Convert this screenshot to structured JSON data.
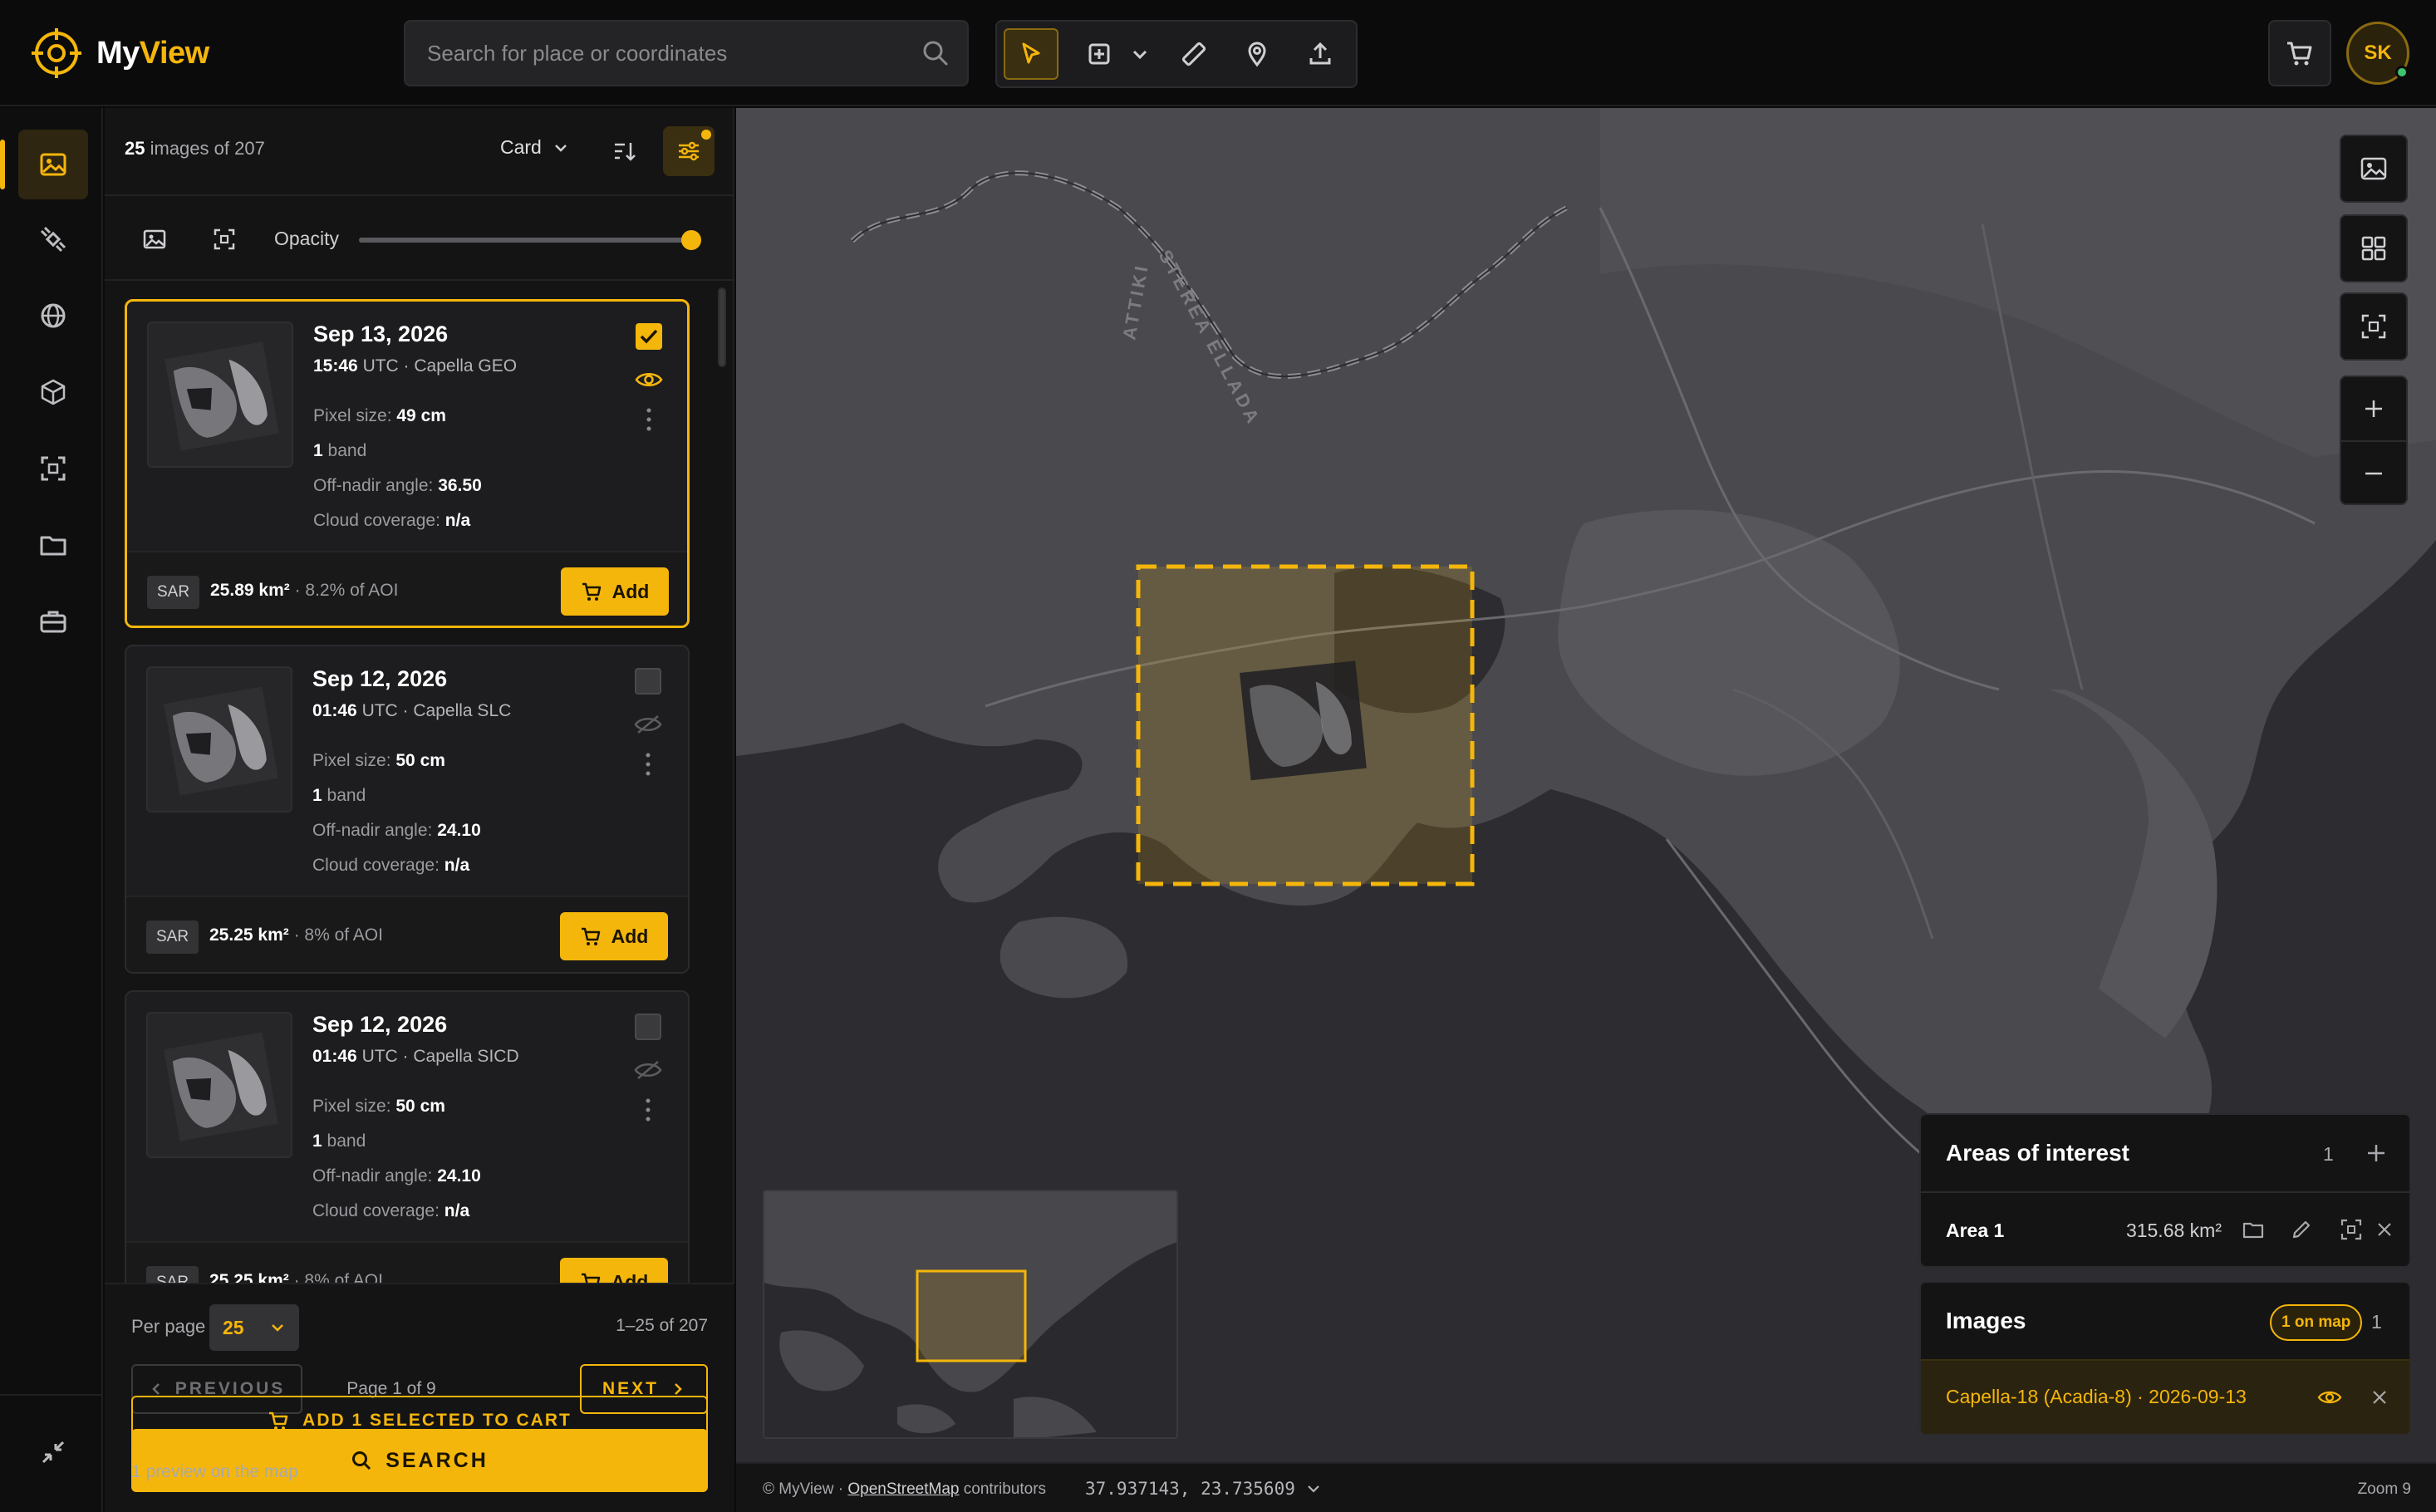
{
  "app": {
    "name_main": "My",
    "name_accent": "View"
  },
  "search": {
    "placeholder": "Search for place or coordinates"
  },
  "user": {
    "initials": "SK"
  },
  "results": {
    "shown": "25",
    "label": "images of 207",
    "view_mode": "Card"
  },
  "opacity": {
    "label": "Opacity",
    "value": 1.0
  },
  "cards": [
    {
      "date": "Sep 13, 2026",
      "time": "15:46",
      "tz_product": "UTC · Capella GEO",
      "pixel_label": "Pixel size:",
      "pixel_value": "49 cm",
      "bands_value": "1",
      "bands_label": "band",
      "angle_label": "Off-nadir angle:",
      "angle_value": "36.50",
      "cloud_label": "Cloud coverage:",
      "cloud_value": "n/a",
      "badge": "SAR",
      "area": "25.89 km²",
      "aoi_pct": "· 8.2% of AOI",
      "add_label": "Add",
      "selected": true,
      "visible": true
    },
    {
      "date": "Sep 12, 2026",
      "time": "01:46",
      "tz_product": "UTC · Capella SLC",
      "pixel_label": "Pixel size:",
      "pixel_value": "50 cm",
      "bands_value": "1",
      "bands_label": "band",
      "angle_label": "Off-nadir angle:",
      "angle_value": "24.10",
      "cloud_label": "Cloud coverage:",
      "cloud_value": "n/a",
      "badge": "SAR",
      "area": "25.25 km²",
      "aoi_pct": "· 8% of AOI",
      "add_label": "Add",
      "selected": false,
      "visible": false
    },
    {
      "date": "Sep 12, 2026",
      "time": "01:46",
      "tz_product": "UTC · Capella SICD",
      "pixel_label": "Pixel size:",
      "pixel_value": "50 cm",
      "bands_value": "1",
      "bands_label": "band",
      "angle_label": "Off-nadir angle:",
      "angle_value": "24.10",
      "cloud_label": "Cloud coverage:",
      "cloud_value": "n/a",
      "badge": "SAR",
      "area": "25.25 km²",
      "aoi_pct": "· 8% of AOI",
      "add_label": "Add",
      "selected": false,
      "visible": false
    }
  ],
  "pagination": {
    "per_page_label": "Per page",
    "per_page": "25",
    "range": "1–25 of 207",
    "prev": "PREVIOUS",
    "page": "Page 1 of 9",
    "next": "NEXT"
  },
  "actions": {
    "search": "SEARCH",
    "add_selected": "ADD 1 SELECTED TO CART",
    "preview_note": "1 preview on the map"
  },
  "map": {
    "labels": [
      "ATTIKI",
      "STEREA ELLADA"
    ],
    "attribution_prefix": "© MyView ·",
    "attribution_link": "OpenStreetMap",
    "attribution_suffix": "contributors",
    "coordinates": "37.937143, 23.735609",
    "zoom": "Zoom 9"
  },
  "aoi": {
    "title": "Areas of interest",
    "count": "1",
    "items": [
      {
        "name": "Area 1",
        "area": "315.68 km²"
      }
    ]
  },
  "images": {
    "title": "Images",
    "on_map": "1 on map",
    "count": "1",
    "items": [
      {
        "name": "Capella-18 (Acadia-8) · 2026-09-13"
      }
    ]
  },
  "colors": {
    "accent": "#f5b60b",
    "background": "#0b0b0c",
    "panel": "#141415",
    "map_water": "#2d2d31",
    "map_land": "#4a4a4e"
  },
  "icons": {
    "rail": [
      "image-icon",
      "satellite-icon",
      "globe-icon",
      "cube-icon",
      "focus-icon",
      "folder-icon",
      "briefcase-icon",
      "collapse-icon"
    ],
    "toolbar": [
      "cursor-icon",
      "add-shape-icon",
      "chevron-down-icon",
      "ruler-icon",
      "pin-icon",
      "upload-icon"
    ]
  }
}
